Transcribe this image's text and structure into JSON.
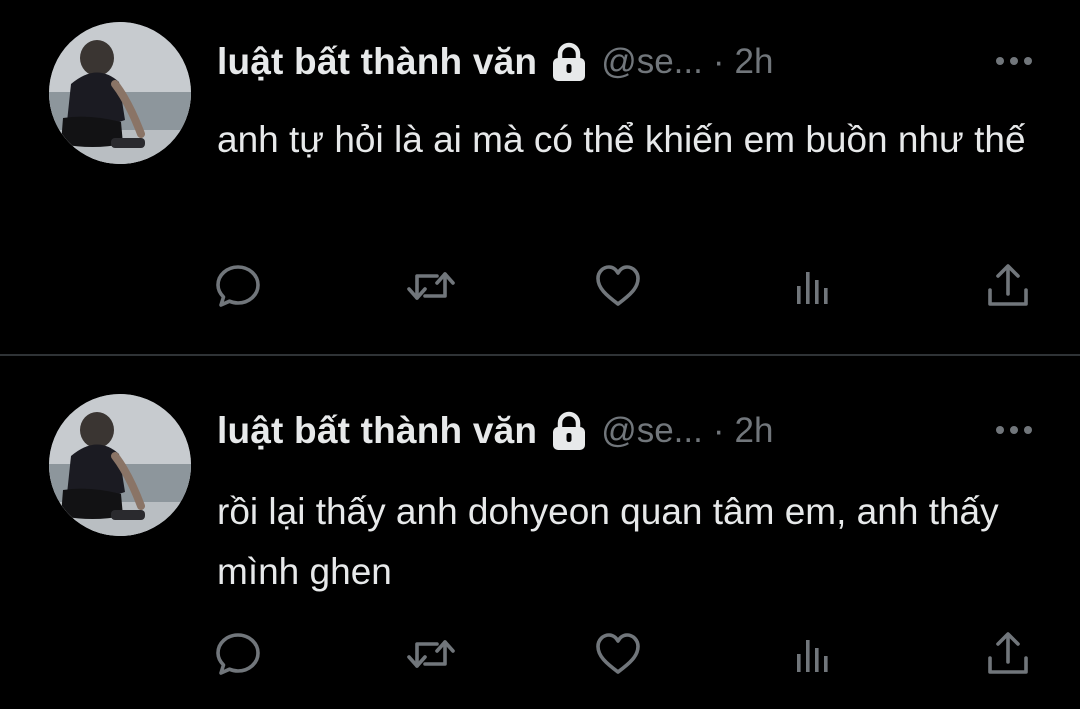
{
  "tweets": [
    {
      "display_name": "luật bất thành văn",
      "handle": "@se...",
      "separator": "·",
      "time": "2h",
      "text": "anh tự hỏi là ai mà có thể khiến em buồn như thế"
    },
    {
      "display_name": "luật bất thành văn",
      "handle": "@se...",
      "separator": "·",
      "time": "2h",
      "text": "rồi lại thấy anh dohyeon quan tâm em, anh thấy mình ghen"
    }
  ],
  "icons": {
    "lock": "lock-icon",
    "more": "more-icon",
    "reply": "reply-icon",
    "retweet": "retweet-icon",
    "like": "heart-icon",
    "views": "views-icon",
    "share": "share-icon"
  },
  "colors": {
    "background": "#000000",
    "primary_text": "#e7e9ea",
    "secondary_text": "#71767b",
    "divider": "#2f3336"
  }
}
